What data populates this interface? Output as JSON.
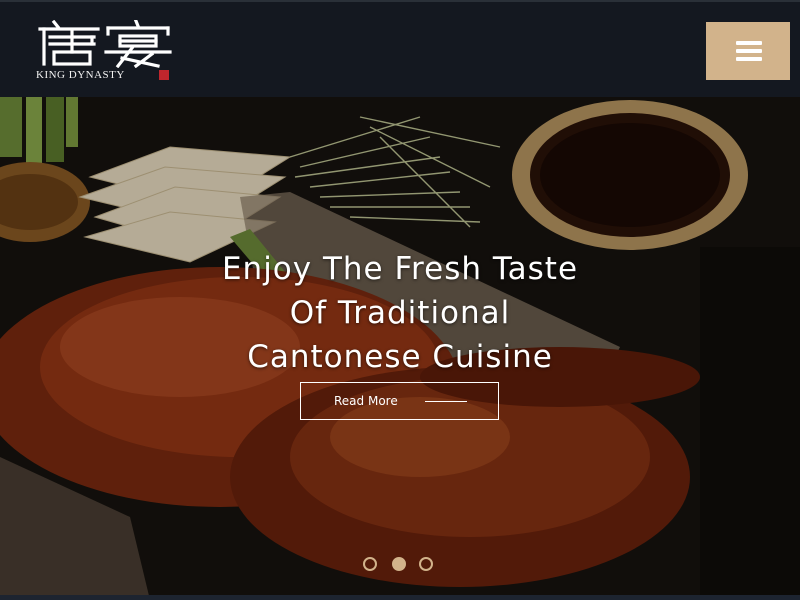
{
  "header": {
    "logo": {
      "chinese_text": "唐宴",
      "english_text": "KING DYNASTY"
    },
    "menu_button": {
      "icon": "hamburger-menu-icon",
      "background_color": "#d2b38b"
    }
  },
  "hero": {
    "title_lines": [
      "Enjoy The Fresh Taste",
      "Of Traditional",
      "Cantonese Cuisine"
    ],
    "button": {
      "label": "Read More",
      "icon": "arrow-line-icon"
    },
    "slider": {
      "slide_count": 3,
      "active_slide": 2
    }
  },
  "colors": {
    "header_bg": "#141820",
    "accent_gold": "#d2b38b",
    "text": "#ffffff"
  }
}
